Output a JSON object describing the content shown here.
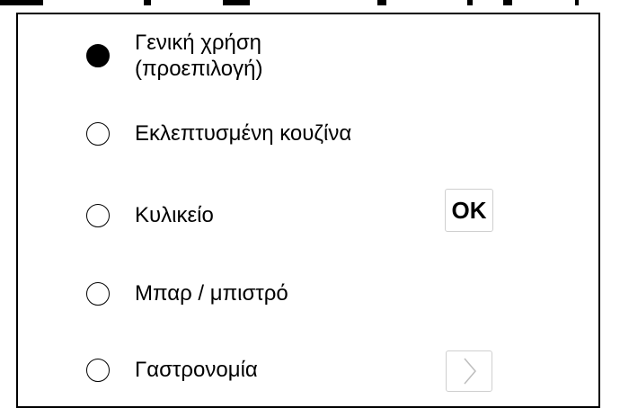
{
  "options": [
    {
      "label": "Γενική χρήση\n(προεπιλογή)",
      "selected": true
    },
    {
      "label": "Εκλεπτυσμένη κουζίνα",
      "selected": false
    },
    {
      "label": "Κυλικείο",
      "selected": false
    },
    {
      "label": "Μπαρ / μπιστρό",
      "selected": false
    },
    {
      "label": "Γαστρονομία",
      "selected": false
    }
  ],
  "ok_button": {
    "label": "OK"
  },
  "next_button": {
    "icon": "chevron-right-icon"
  },
  "colors": {
    "accent": "#000000",
    "button_border": "#cfcfcf",
    "background": "#ffffff"
  }
}
